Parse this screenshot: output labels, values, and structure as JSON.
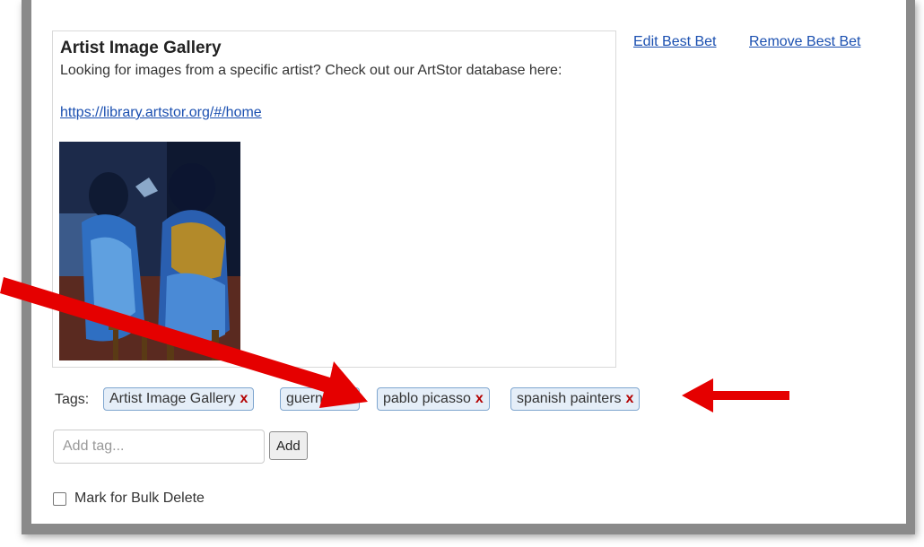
{
  "best_bet": {
    "title": "Artist Image Gallery",
    "description": "Looking for images from a specific artist? Check out our ArtStor database here:",
    "link": "https://library.artstor.org/#/home",
    "image_alt": "painting of two seated women in blue"
  },
  "actions": {
    "edit_label": "Edit Best Bet",
    "remove_label": "Remove Best Bet"
  },
  "tags": {
    "label": "Tags:",
    "remove_symbol": "x",
    "items": [
      {
        "label": "Artist Image Gallery"
      },
      {
        "label": "guernica"
      },
      {
        "label": "pablo picasso"
      },
      {
        "label": "spanish painters"
      }
    ]
  },
  "add_tag": {
    "placeholder": "Add tag...",
    "button_label": "Add"
  },
  "bulk_delete": {
    "label": "Mark for Bulk Delete",
    "checked": false
  },
  "colors": {
    "link": "#1a4fb0",
    "tag_border": "#7fa6cf",
    "tag_bg": "#e5eef8",
    "remove_x": "#b30000",
    "arrow": "#e50000"
  }
}
